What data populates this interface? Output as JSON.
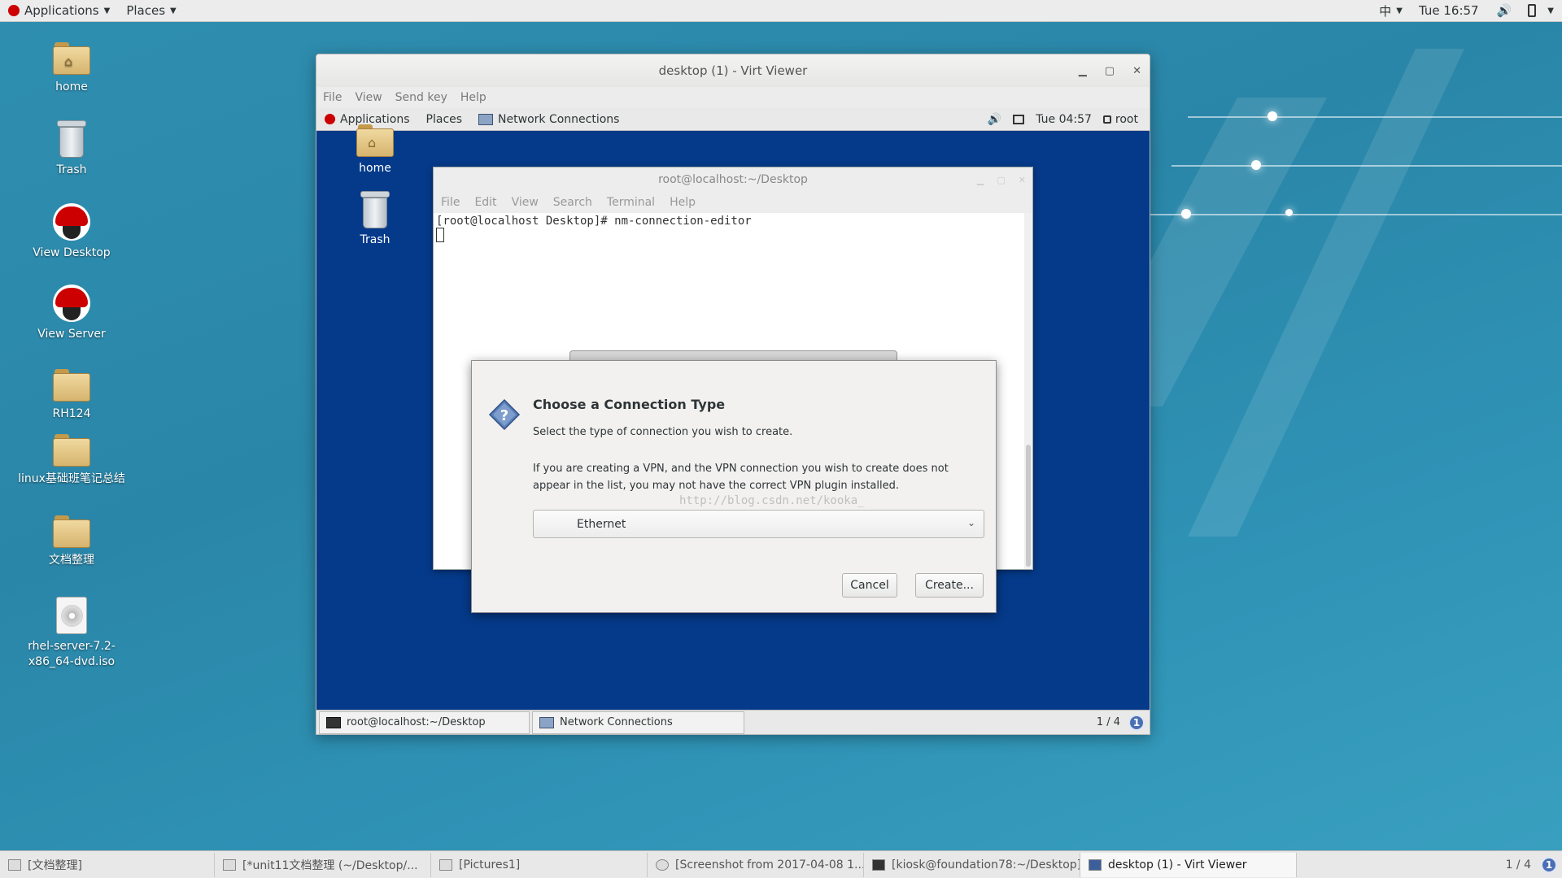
{
  "host_topbar": {
    "applications": "Applications",
    "places": "Places",
    "input_method": "中",
    "clock": "Tue 16:57"
  },
  "host_desktop": {
    "icons": [
      {
        "label": "home"
      },
      {
        "label": "Trash"
      },
      {
        "label": "View Desktop"
      },
      {
        "label": "View Server"
      },
      {
        "label": "RH124"
      },
      {
        "label": "linux基础班笔记总结"
      },
      {
        "label": "文档整理"
      },
      {
        "label": "rhel-server-7.2-x86_64-dvd.iso"
      }
    ]
  },
  "virt_viewer": {
    "title": "desktop (1) - Virt Viewer",
    "menu": [
      "File",
      "View",
      "Send key",
      "Help"
    ]
  },
  "guest": {
    "topbar": {
      "applications": "Applications",
      "places": "Places",
      "window_title": "Network Connections",
      "clock": "Tue 04:57",
      "user": "root"
    },
    "desktop_icons": [
      {
        "label": "home"
      },
      {
        "label": "Trash"
      }
    ],
    "terminal": {
      "title": "root@localhost:~/Desktop",
      "menu": [
        "File",
        "Edit",
        "View",
        "Search",
        "Terminal",
        "Help"
      ],
      "command_line": "[root@localhost Desktop]# nm-connection-editor"
    },
    "dialog": {
      "heading": "Choose a Connection Type",
      "subtitle": "Select the type of connection you wish to create.",
      "note": "If you are creating a VPN, and the VPN connection you wish to create does not appear in the list, you may not have the correct VPN plugin installed.",
      "watermark": "http://blog.csdn.net/kooka_",
      "connection_type": "Ethernet",
      "cancel_label": "Cancel",
      "create_label": "Create..."
    },
    "bottombar": {
      "tasks": [
        {
          "label": "root@localhost:~/Desktop"
        },
        {
          "label": "Network Connections"
        }
      ],
      "workspace": "1 / 4",
      "info": "1"
    }
  },
  "host_bottombar": {
    "tasks": [
      {
        "label": "[文档整理]"
      },
      {
        "label": "[*unit11文档整理 (~/Desktop/..."
      },
      {
        "label": "[Pictures1]"
      },
      {
        "label": "[Screenshot from 2017-04-08 1..."
      },
      {
        "label": "[kiosk@foundation78:~/Desktop]"
      },
      {
        "label": "desktop (1) - Virt Viewer"
      }
    ],
    "workspace": "1 / 4",
    "info": "1"
  }
}
